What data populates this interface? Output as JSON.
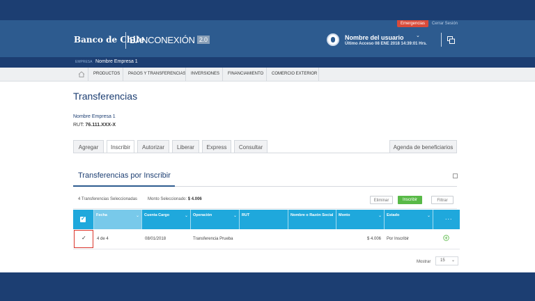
{
  "header": {
    "bank_logo": "Banco de Chile",
    "app_name": "BANCONEXIÓN",
    "app_version": "2.0",
    "emergencias": "Emergencias",
    "cerrar_sesion": "Cerrar Sesión",
    "user_name": "Nombre del usuario",
    "last_access": "Último Acceso 08 ENE 2018 14:39:01 Hrs."
  },
  "company_bar": {
    "label": "EMPRESA",
    "name": "Nombre Empresa 1"
  },
  "nav": {
    "items": [
      "PRODUCTOS",
      "PAGOS Y TRANSFERENCIAS",
      "INVERSIONES",
      "FINANCIAMIENTO",
      "COMERCIO EXTERIOR"
    ]
  },
  "page": {
    "title": "Transferencias",
    "company_name": "Nombre Empresa 1",
    "rut_label": "RUT:",
    "rut_value": "76.111.XXX-X"
  },
  "tabs": [
    "Agregar",
    "Inscribir",
    "Autorizar",
    "Liberar",
    "Express",
    "Consultar"
  ],
  "active_tab": "Inscribir",
  "beneficiarios_tab": "Agenda de beneficiarios",
  "section": {
    "title": "Transferencias por Inscribir",
    "selected_count": "4 Transferencias Seleccionadas",
    "amount_label": "Monto Seleccionado:",
    "amount_value": "$ 4.006",
    "btn_eliminar": "Eliminar",
    "btn_inscribir": "Inscribir",
    "btn_filtrar": "Filtrar"
  },
  "table": {
    "columns": [
      "Fecha",
      "Cuenta Cargo",
      "Operación",
      "RUT",
      "Nombre o Razón Social",
      "Monto",
      "Estado"
    ],
    "more": "...",
    "rows": [
      {
        "check": "✓",
        "fecha": "4 de 4",
        "cuenta": "08/01/2018",
        "operacion": "Transferencia Prueba",
        "rut": "",
        "nombre": "",
        "monto": "$ 4.006",
        "estado": "Por Inscribir"
      }
    ]
  },
  "pagination": {
    "label": "Mostrar",
    "value": "15"
  },
  "colors": {
    "header": "#2d5b8f",
    "dark_blue": "#1c3e72",
    "table_head": "#1fa8dc",
    "green": "#58b947",
    "emergency": "#d94b3a"
  }
}
